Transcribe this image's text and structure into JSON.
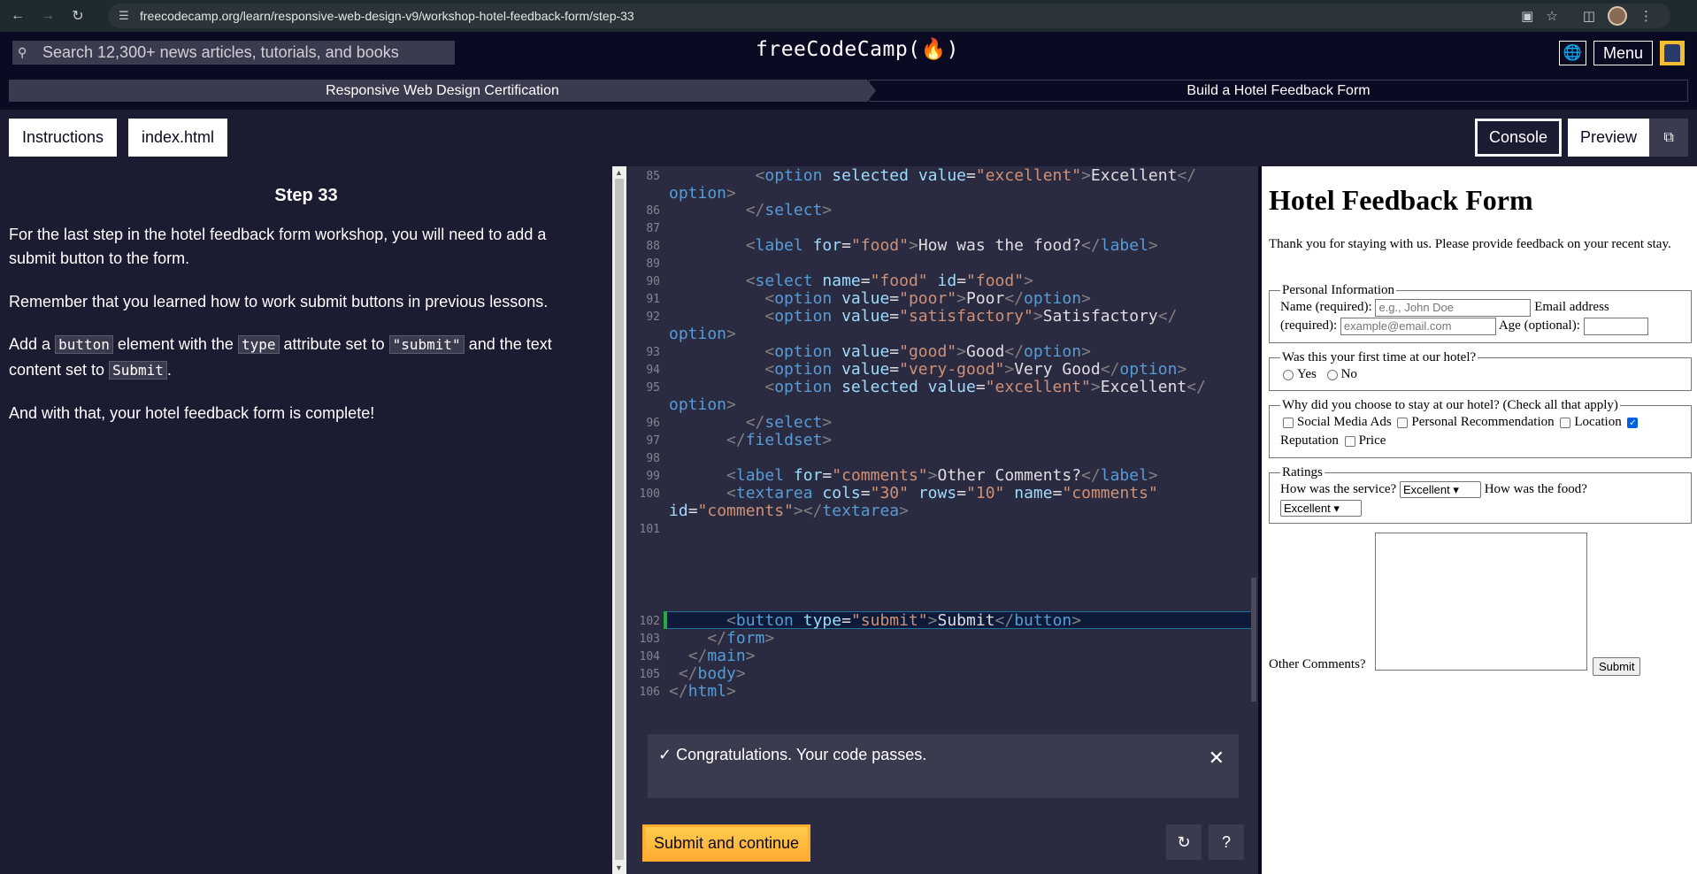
{
  "browser": {
    "url": "freecodecamp.org/learn/responsive-web-design-v9/workshop-hotel-feedback-form/step-33"
  },
  "header": {
    "search_placeholder": "Search 12,300+ news articles, tutorials, and books",
    "logo": "freeCodeCamp(🔥)",
    "menu_label": "Menu"
  },
  "breadcrumb": {
    "certification": "Responsive Web Design Certification",
    "workshop": "Build a Hotel Feedback Form"
  },
  "tabs": {
    "instructions": "Instructions",
    "file": "index.html",
    "console": "Console",
    "preview": "Preview"
  },
  "instructions": {
    "title": "Step 33",
    "p1": "For the last step in the hotel feedback form workshop, you will need to add a submit button to the form.",
    "p2": "Remember that you learned how to work submit buttons in previous lessons.",
    "p3_a": "Add a",
    "p3_code1": "button",
    "p3_b": "element with the",
    "p3_code2": "type",
    "p3_c": "attribute set to",
    "p3_code3": "\"submit\"",
    "p3_d": "and the text content set to",
    "p3_code4": "Submit",
    "p3_e": ".",
    "p4": "And with that, your hotel feedback form is complete!"
  },
  "editor": {
    "line_numbers": [
      "85",
      "86",
      "87",
      "88",
      "89",
      "90",
      "91",
      "92",
      "93",
      "94",
      "95",
      "96",
      "97",
      "98",
      "99",
      "100",
      "101",
      "102",
      "103",
      "104",
      "105",
      "106"
    ]
  },
  "feedback": {
    "message": "✓ Congratulations. Your code passes.",
    "submit_label": "Submit and continue"
  },
  "preview_page": {
    "heading": "Hotel Feedback Form",
    "intro": "Thank you for staying with us. Please provide feedback on your recent stay.",
    "personal_legend": "Personal Information",
    "name_label": "Name (required):",
    "name_placeholder": "e.g., John Doe",
    "email_label_a": "Email address",
    "email_label_b": "(required):",
    "email_placeholder": "example@email.com",
    "age_label": "Age (optional):",
    "first_time_legend": "Was this your first time at our hotel?",
    "yes": "Yes",
    "no": "No",
    "why_legend": "Why did you choose to stay at our hotel? (Check all that apply)",
    "opt_social": "Social Media Ads",
    "opt_personal": "Personal Recommendation",
    "opt_location": "Location",
    "opt_reputation": "Reputation",
    "opt_price": "Price",
    "ratings_legend": "Ratings",
    "service_label": "How was the service?",
    "service_value": "Excellent",
    "food_label": "How was the food?",
    "food_value": "Excellent",
    "comments_label": "Other Comments?",
    "submit": "Submit"
  },
  "colors": {
    "accent": "#feac32",
    "background": "#0a0a23",
    "panel": "#1b1b32",
    "editor_bg": "#2a2a40"
  }
}
